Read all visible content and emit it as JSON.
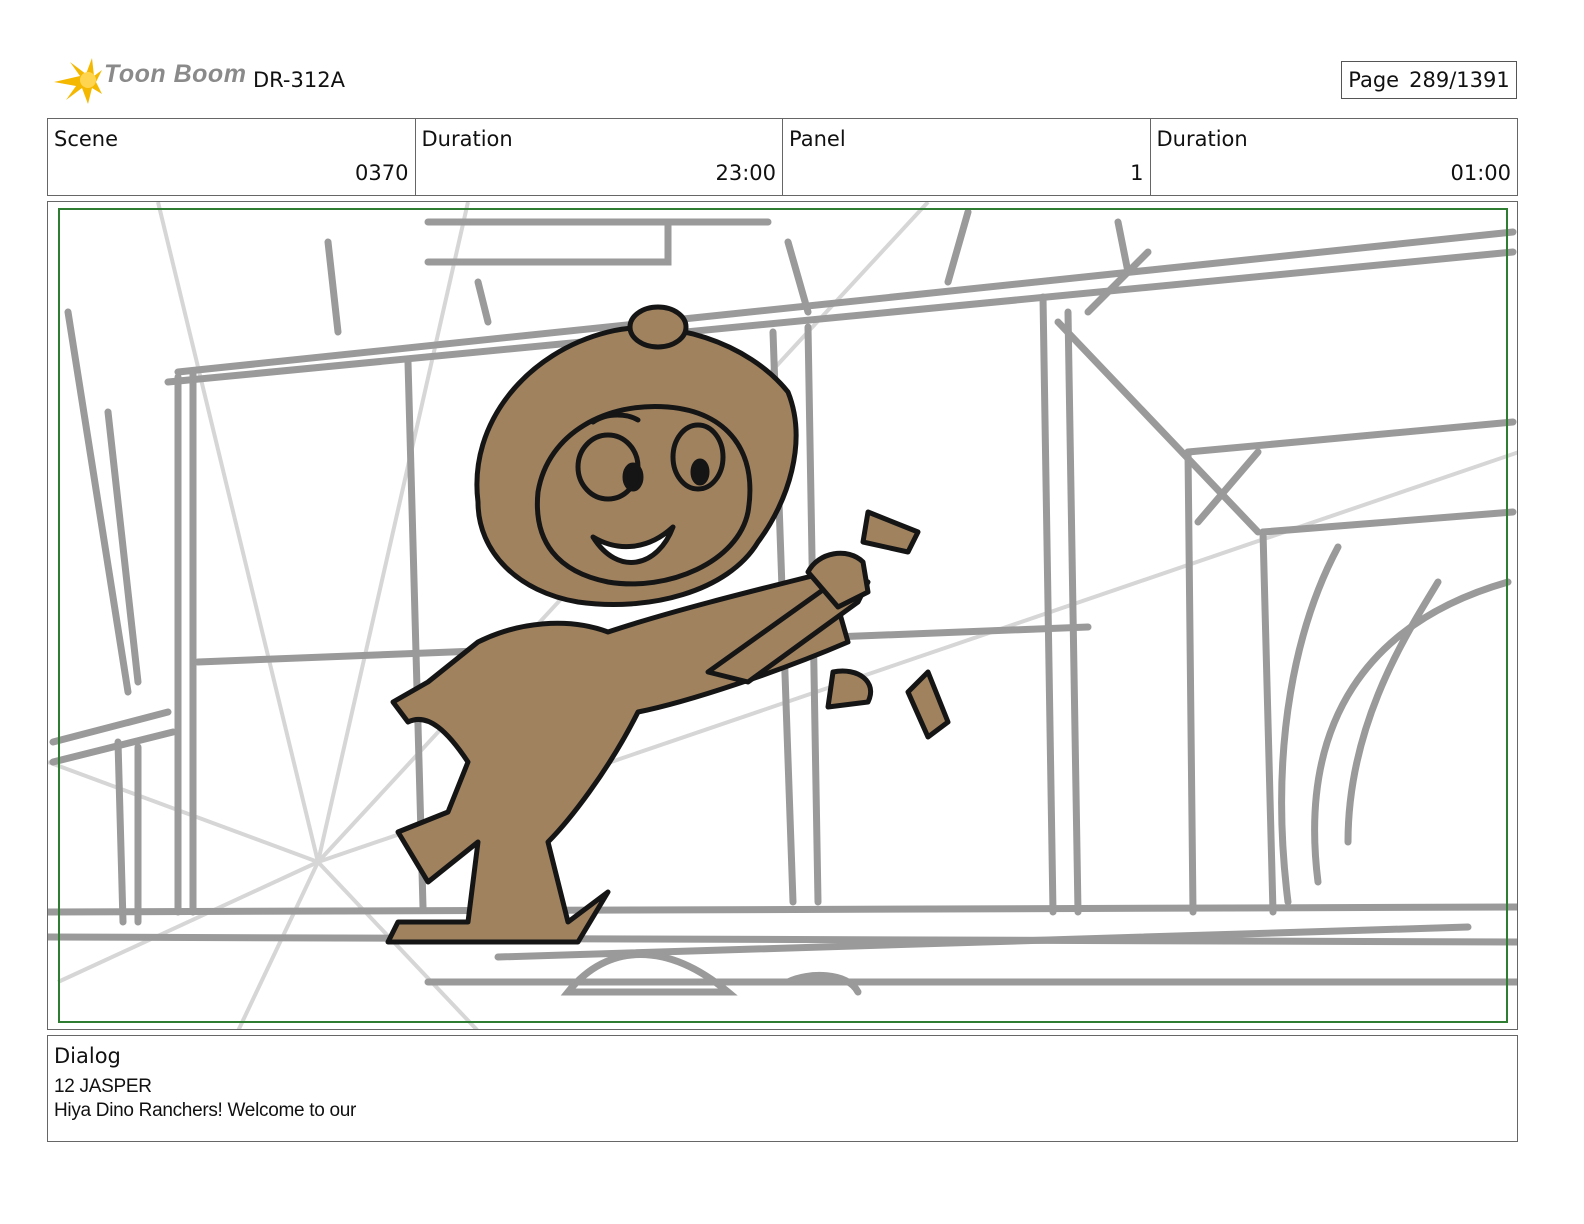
{
  "header": {
    "logo_text": "Toon Boom",
    "project_code": "DR-312A",
    "page_label": "Page",
    "page_value": "289/1391"
  },
  "info": {
    "scene_label": "Scene",
    "scene_value": "0370",
    "scene_duration_label": "Duration",
    "scene_duration_value": "23:00",
    "panel_label": "Panel",
    "panel_value": "1",
    "panel_duration_label": "Duration",
    "panel_duration_value": "01:00"
  },
  "dialog": {
    "title": "Dialog",
    "speaker": "12 JASPER",
    "line": "Hiya Dino Ranchers! Welcome to our"
  },
  "colors": {
    "sketch_gray": "#9a9a9a",
    "character_fill": "#a0825f",
    "safe_frame": "#2e7d32",
    "logo_accent": "#f5b800"
  }
}
